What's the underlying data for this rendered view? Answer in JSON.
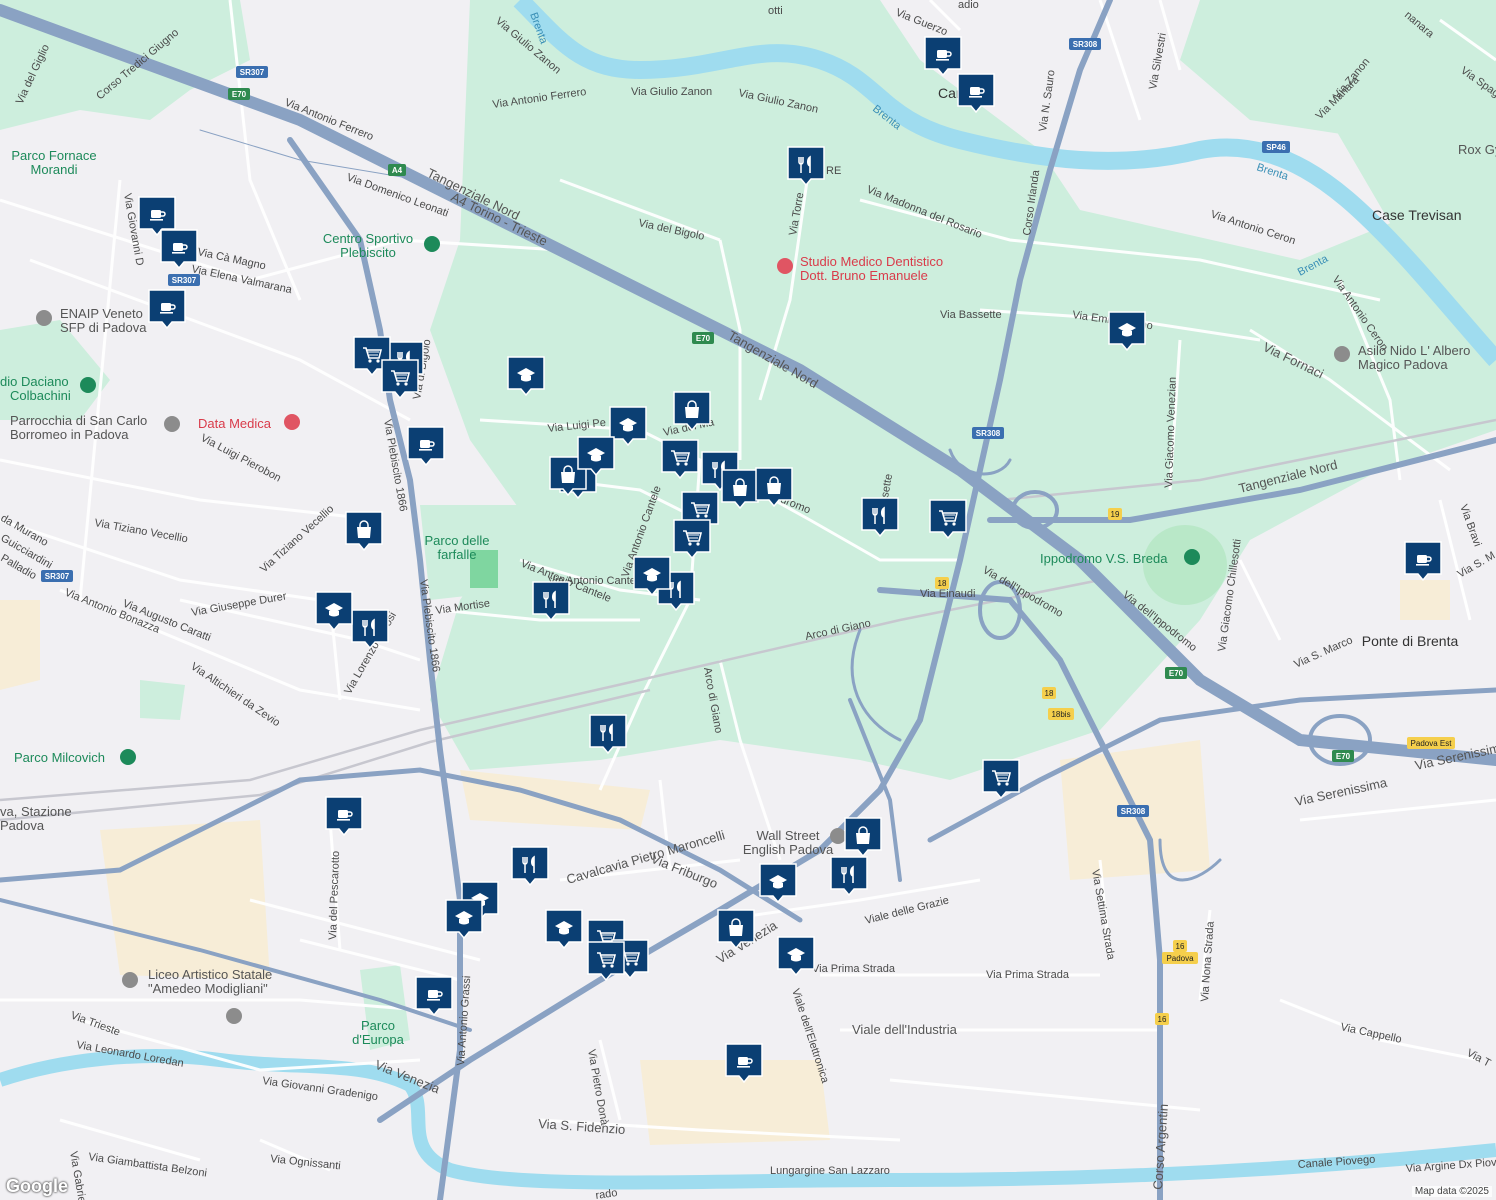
{
  "map": {
    "logo": "Google",
    "attribution": "Map data ©2025",
    "colors": {
      "land": "#f1f0f3",
      "park": "#cdeedd",
      "water": "#9fdcef",
      "highway": "#8aa2c3",
      "road": "#ffffff",
      "marker": "#0b3f73"
    },
    "places": [
      "Camin",
      "Case Trevisan",
      "Ponte di Brenta",
      "Rox Gy",
      "Parco Fornace",
      "Morandi",
      "Centro Sportivo",
      "Plebiscito",
      "Studio Medico Dentistico",
      "Dott. Bruno Emanuele",
      "Asilo Nido L' Albero",
      "Magico Padova",
      "ENAIP Veneto",
      "SFP di Padova",
      "dio Daciano",
      "Colbachini",
      "Parrocchia di San Carlo",
      "Borromeo in Padova",
      "Data Medica",
      "Parco delle",
      "farfalle",
      "Ippodromo V.S. Breda",
      "Wall Street",
      "English Padova",
      "Parco Milcovich",
      "Liceo Artistico Statale",
      "\"Amedeo Modigliani\"",
      "Parco",
      "d'Europa",
      "va, Stazione",
      "Padova"
    ],
    "streets": [
      "Via Guerzo",
      "adio",
      "Via Giulio Zanon",
      "Via Antonio Ferrero",
      "Via Giulio Zanon",
      "Via Giulio Zanon",
      "otti",
      "Via Antonio Ferrero",
      "Corso Tredici Giugno",
      "Via del Giglio",
      "Via Domenico Leonati",
      "Tangenziale Nord",
      "A4 Torino - Trieste",
      "Via del Bigolo",
      "Via Torre",
      "RE",
      "Via Madonna del Rosario",
      "Corso Irlanda",
      "Via N. Sauro",
      "Via Silvestri",
      "Via Manara",
      "Via Zanon",
      "Via Spag",
      "nanara",
      "Via Antonio Ceron",
      "Via Antonio Ceron",
      "Via Bassette",
      "Via Emilio Bruno",
      "Via Fornaci",
      "Tangenziale Nord",
      "Via Giacomo Venezian",
      "Tangenziale Nord",
      "Via Cà Magno",
      "Via Elena Valmarana",
      "Via Giovanni D",
      "Via Luigi Pierobon",
      "Via Luigi Pe",
      "Via del Ma",
      "Via Plebiscito 1866",
      "Via di Bigolo",
      "Via Tiziano Vecellio",
      "Via Tiziano Vecellio",
      "da Murano",
      "Guicciardini",
      "Palladio",
      "Via Antonio Bonazza",
      "Via Augusto Caratti",
      "Via Giuseppe Durer",
      "Via Mortise",
      "Via Antonio Cantele",
      "Via Antonio Cantele",
      "Via Antonio Cantele",
      "Ippodromo",
      "sette",
      "Via dell'Ippodromo",
      "Via dell'Ippodromo",
      "Via Einaudi",
      "Arco di Giano",
      "Arco di Giano",
      "Via Altichieri da Zevio",
      "Via Lorenzo Perosi",
      "Via Plebiscito 1866",
      "Via Giacomo Chillesotti",
      "Via S. Marco",
      "Via Bravi",
      "Via S. M",
      "Via Serenissima",
      "Via Serenissima",
      "Via del Pescarotto",
      "Via Antonio Grassi",
      "Cavalcavia Pietro Maroncelli",
      "Via Friburgo",
      "Via Settima Strada",
      "Via Nona Strada",
      "Viale delle Grazie",
      "Via Venezia",
      "Via Prima Strada",
      "Via Prima Strada",
      "Viale dell'Elettronica",
      "Viale dell'Industria",
      "Via Cappello",
      "Via T",
      "Via Trieste",
      "Via Leonardo Loredan",
      "Via Giovanni Gradenigo",
      "Via Venezia",
      "Via Pietro Donà",
      "Via S. Fidenzio",
      "Via Giambattista Belzoni",
      "Via Ognissanti",
      "Via Gabriel",
      "Lungargine San Lazzaro",
      "Corso Argentin",
      "Canale Piovego",
      "Via Argine Dx Piove",
      "rado",
      "Brenta",
      "Brenta",
      "Brenta",
      "Brenta"
    ],
    "shields": [
      "SR307",
      "E70",
      "A4",
      "SR307",
      "SR307",
      "SR308",
      "SP46",
      "E70",
      "SR308",
      "19",
      "18",
      "18",
      "18bis",
      "E70",
      "SR308",
      "E70",
      "Padova Est",
      "16",
      "Padova",
      "16"
    ],
    "markers": [
      "coffee",
      "coffee",
      "coffee",
      "coffee",
      "coffee",
      "coffee",
      "coffee",
      "coffee",
      "coffee",
      "coffee",
      "restaurant",
      "restaurant",
      "restaurant",
      "restaurant",
      "restaurant",
      "restaurant",
      "restaurant",
      "restaurant",
      "restaurant",
      "restaurant",
      "shopping",
      "shopping",
      "shopping",
      "shopping",
      "shopping",
      "shopping",
      "shopping",
      "shopping",
      "grocery",
      "grocery",
      "grocery",
      "grocery",
      "grocery",
      "grocery",
      "grocery",
      "grocery",
      "grocery",
      "grocery",
      "school",
      "school",
      "school",
      "school",
      "school",
      "school",
      "school",
      "school",
      "school",
      "school",
      "school"
    ]
  }
}
